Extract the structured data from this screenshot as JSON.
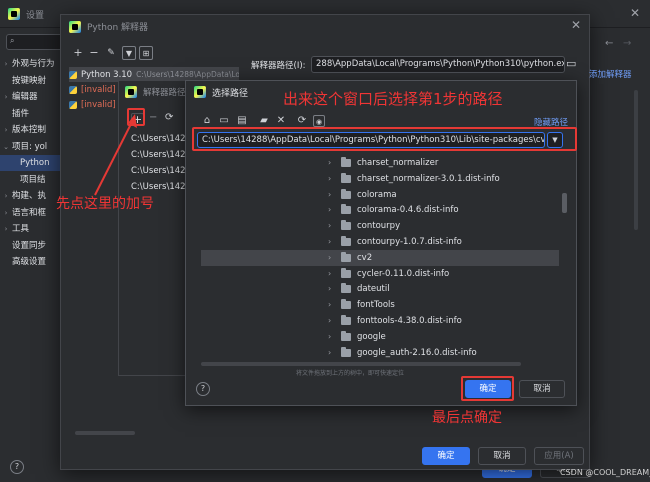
{
  "settings": {
    "title": "设置",
    "tree": [
      {
        "label": "外观与行为",
        "expandable": true
      },
      {
        "label": "按键映射",
        "expandable": false
      },
      {
        "label": "编辑器",
        "expandable": true
      },
      {
        "label": "插件",
        "expandable": false
      },
      {
        "label": "版本控制",
        "expandable": true
      },
      {
        "label": "项目: yol",
        "expandable": true
      },
      {
        "label": "Python",
        "expandable": false
      },
      {
        "label": "项目结",
        "expandable": false
      },
      {
        "label": "构建、执",
        "expandable": true
      },
      {
        "label": "语言和框",
        "expandable": true
      },
      {
        "label": "工具",
        "expandable": true
      },
      {
        "label": "设置同步",
        "expandable": false
      },
      {
        "label": "高级设置",
        "expandable": false
      }
    ],
    "ok_label": "确定",
    "cancel_label": "取消"
  },
  "interp_dialog": {
    "title": "Python 解释器",
    "interpreters": [
      {
        "label": "Python 3.10",
        "path": "C:\\Users\\14288\\AppData\\Local\\...",
        "invalid": false
      },
      {
        "label": "[invalid]",
        "path": "Py...",
        "invalid": true
      },
      {
        "label": "[invalid]",
        "path": "",
        "invalid": true
      }
    ],
    "path_label": "解释器路径(I):",
    "path_value": "288\\AppData\\Local\\Programs\\Python\\Python310\\python.exe",
    "add_interpreter": "添加解释器",
    "ok_label": "确定",
    "cancel_label": "取消",
    "apply_label": "应用(A)"
  },
  "paths_dialog": {
    "title": "解释器路径",
    "paths": [
      "C:\\Users\\142",
      "C:\\Users\\142",
      "C:\\Users\\142",
      "C:\\Users\\142"
    ]
  },
  "select_dialog": {
    "title": "选择路径",
    "hide_path": "隐藏路径",
    "path_value": "C:\\Users\\14288\\AppData\\Local\\Programs\\Python\\Python310\\Lib\\site-packages\\cv2",
    "folders": [
      {
        "name": "charset_normalizer",
        "selected": false
      },
      {
        "name": "charset_normalizer-3.0.1.dist-info",
        "selected": false
      },
      {
        "name": "colorama",
        "selected": false
      },
      {
        "name": "colorama-0.4.6.dist-info",
        "selected": false
      },
      {
        "name": "contourpy",
        "selected": false
      },
      {
        "name": "contourpy-1.0.7.dist-info",
        "selected": false
      },
      {
        "name": "cv2",
        "selected": true
      },
      {
        "name": "cycler-0.11.0.dist-info",
        "selected": false
      },
      {
        "name": "dateutil",
        "selected": false
      },
      {
        "name": "fontTools",
        "selected": false
      },
      {
        "name": "fonttools-4.38.0.dist-info",
        "selected": false
      },
      {
        "name": "google",
        "selected": false
      },
      {
        "name": "google_auth-2.16.0.dist-info",
        "selected": false
      }
    ],
    "hint": "将文件拖放到上方的树中，即可快速定位",
    "ok_label": "确定",
    "cancel_label": "取消"
  },
  "annotations": {
    "top": "出来这个窗口后选择第1步的路径",
    "left": "先点这里的加号",
    "bottom": "最后点确定"
  },
  "watermark": "CSDN @COOL_DREAM_",
  "colors": {
    "accent": "#3574f0",
    "annotation": "#e53935",
    "bg": "#2b2d30"
  }
}
